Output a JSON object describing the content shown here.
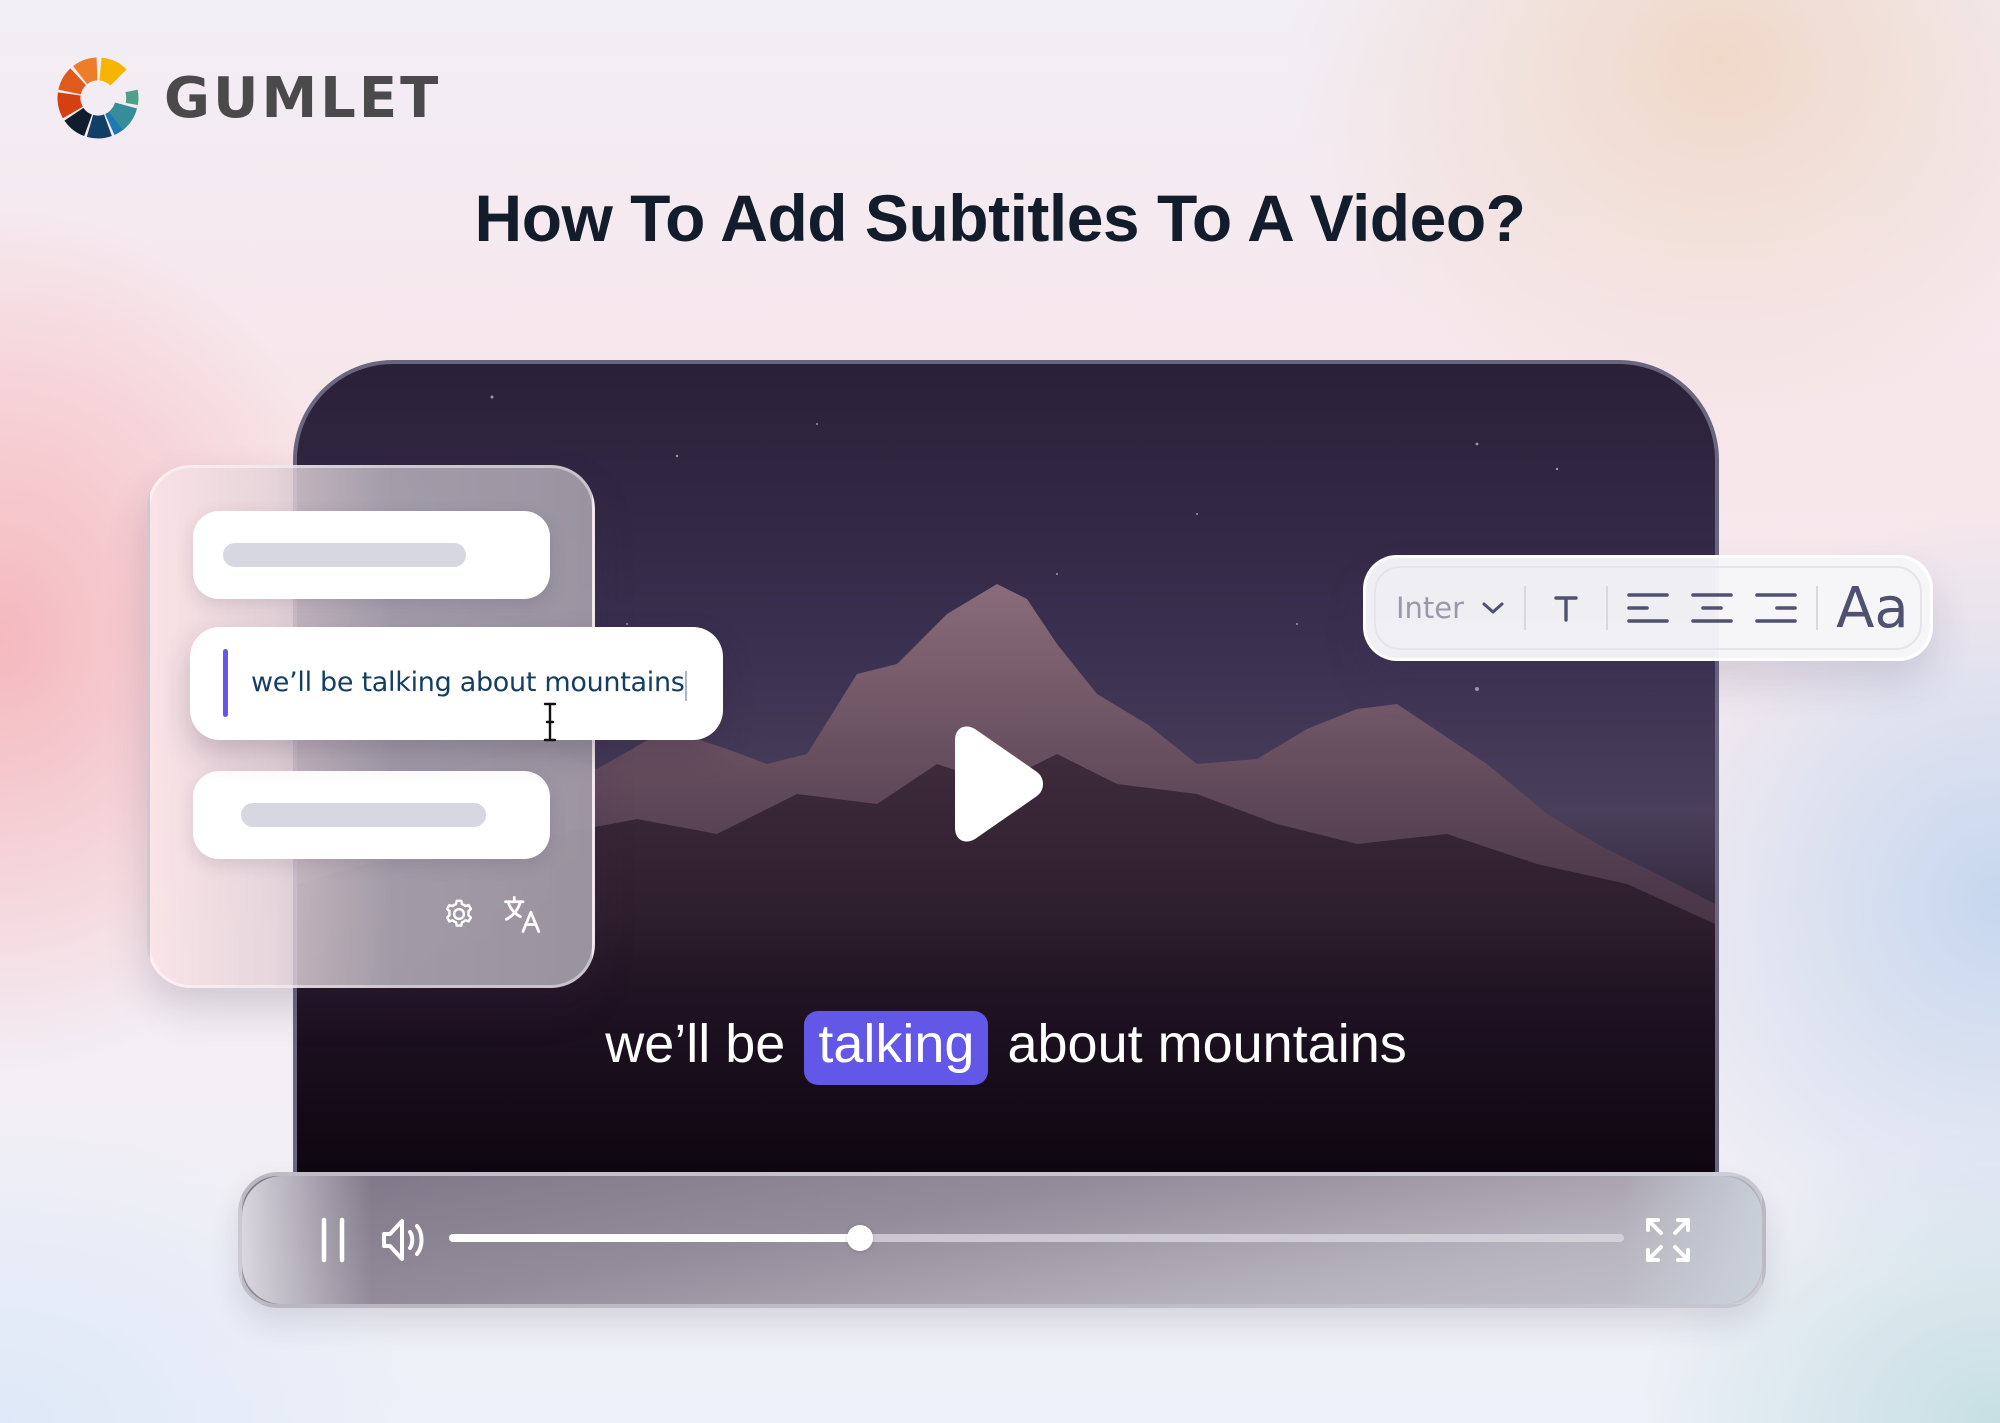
{
  "brand": {
    "name": "GUMLET",
    "logo_segment_colors": [
      "#f7b500",
      "#ee7d2a",
      "#e05a1c",
      "#d54012",
      "#0f1d2c",
      "#123f66",
      "#1f78b4",
      "#378c99",
      "#4fa08a"
    ]
  },
  "page": {
    "title": "How To Add Subtitles To A Video?"
  },
  "subtitle_editor": {
    "cues": [
      {
        "state": "collapsed",
        "text": ""
      },
      {
        "state": "editing",
        "text": "we’ll be talking about mountains"
      },
      {
        "state": "collapsed",
        "text": ""
      }
    ],
    "active_cue_text": "we’ll be talking about mountains",
    "icons": [
      "gear-icon",
      "translate-icon"
    ],
    "accent_color": "#6357e8"
  },
  "format_toolbar": {
    "font_family_value": "Inter",
    "buttons": [
      "text-style",
      "align-left",
      "align-center",
      "align-right"
    ],
    "case_label": "Aa",
    "icon_color": "#4f5170"
  },
  "video": {
    "caption": {
      "before": "we’ll be",
      "highlight": "talking",
      "after": "about mountains"
    },
    "highlight_color": "#6357e8",
    "state": "paused-overlay-play"
  },
  "player_controls": {
    "pause_icon": "pause-icon",
    "volume_icon": "volume-icon",
    "fullscreen_icon": "fullscreen-icon",
    "progress_percent": 35
  }
}
